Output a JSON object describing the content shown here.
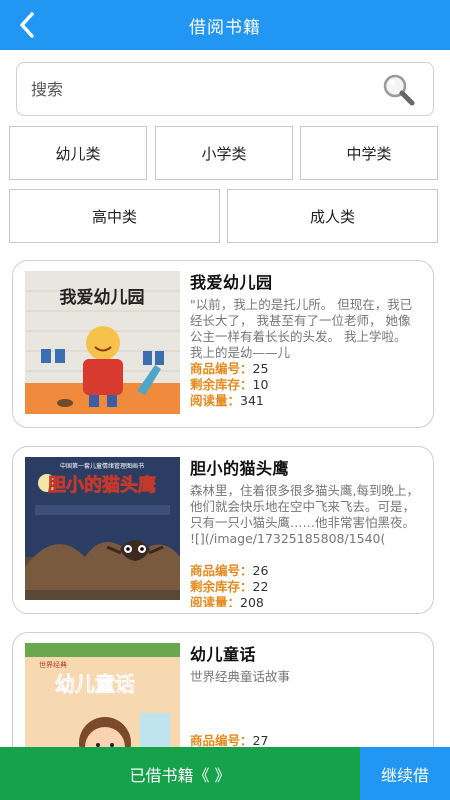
{
  "header": {
    "title": "借阅书籍",
    "back_icon": "chevron-left-icon"
  },
  "search": {
    "placeholder": "搜索",
    "icon": "magnifier-icon"
  },
  "categories": [
    {
      "label": "幼儿类"
    },
    {
      "label": "小学类"
    },
    {
      "label": "中学类"
    },
    {
      "label": "高中类"
    },
    {
      "label": "成人类"
    }
  ],
  "books": [
    {
      "title": "我爱幼儿园",
      "cover_title": "我爱幼儿园",
      "description": "\"以前，我上的是托儿所。 但现在，我已经长大了， 我甚至有了一位老师， 她像公主一样有着长长的头发。 我上学啦。 我上的是幼——儿",
      "id_label": "商品编号：",
      "id_value": "25",
      "stock_label": "剩余库存：",
      "stock_value": "10",
      "reads_label": "阅读量：",
      "reads_value": "341"
    },
    {
      "title": "胆小的猫头鹰",
      "cover_title": "胆小的猫头鹰",
      "cover_series": "中国第一套儿童情绪管理图画书",
      "description": "森林里，住着很多很多猫头鹰,每到晚上，他们就会快乐地在空中飞来飞去。可是，只有一只小猫头鹰……他非常害怕黑夜。",
      "extra": "![](/image/17325185808/1540(",
      "id_label": "商品编号：",
      "id_value": "26",
      "stock_label": "剩余库存：",
      "stock_value": "22",
      "reads_label": "阅读量：",
      "reads_value": "208"
    },
    {
      "title": "幼儿童话",
      "cover_title": "幼儿童话",
      "cover_series": "世界经典",
      "description": "世界经典童话故事",
      "id_label": "商品编号：",
      "id_value": "27"
    }
  ],
  "bottom": {
    "borrowed_label": "已借书籍《 》",
    "continue_label": "继续借"
  },
  "colors": {
    "primary": "#2196f3",
    "green": "#15a24a",
    "orange_label": "#e8891d"
  }
}
